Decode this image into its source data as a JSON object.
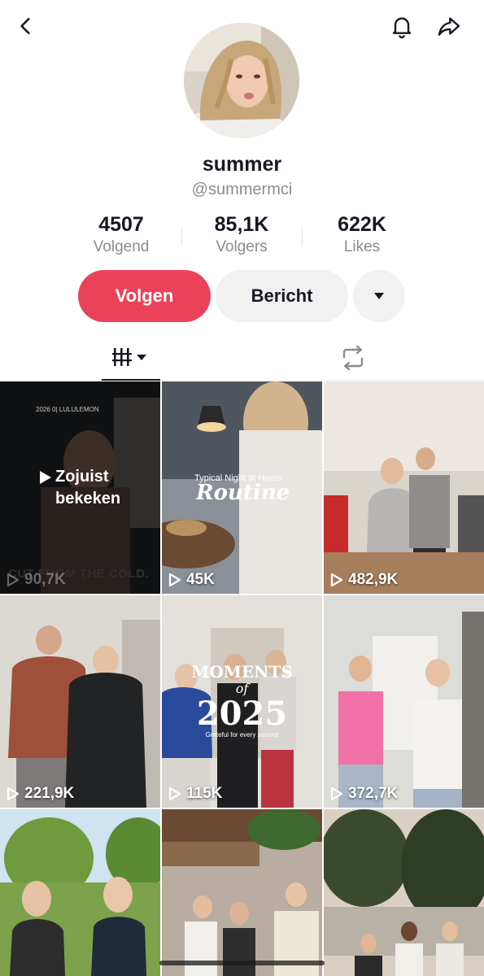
{
  "header": {
    "back_icon": "chevron-left-icon",
    "bell_icon": "bell-icon",
    "share_icon": "share-icon"
  },
  "profile": {
    "display_name": "summer",
    "username": "@summermci"
  },
  "stats": [
    {
      "value": "4507",
      "label": "Volgend"
    },
    {
      "value": "85,1K",
      "label": "Volgers"
    },
    {
      "value": "622K",
      "label": "Likes"
    }
  ],
  "actions": {
    "follow_label": "Volgen",
    "message_label": "Bericht",
    "more_icon": "triangle-down-icon"
  },
  "tabs": {
    "videos_icon": "grid-filter-icon",
    "reposts_icon": "repost-icon"
  },
  "colors": {
    "accent": "#ea4359",
    "secondary_btn": "#f1f1f2",
    "muted_text": "#8a8b91"
  },
  "videos": [
    {
      "views": "90,7K",
      "overlay_line1": "Zojuist",
      "overlay_line2": "bekeken",
      "caption": "CUT FROM THE COLD.",
      "tag": "2026 0| LULULEMON"
    },
    {
      "views": "45K",
      "overlay_line1": "Typical Night at Home",
      "overlay_line2": "Routine"
    },
    {
      "views": "482,9K"
    },
    {
      "views": "221,9K"
    },
    {
      "views": "115K",
      "overlay_line1": "MOMENTS",
      "overlay_line2": "of",
      "overlay_line3": "2025",
      "overlay_line4": "Grateful for every second"
    },
    {
      "views": "372,7K"
    },
    {},
    {},
    {}
  ]
}
